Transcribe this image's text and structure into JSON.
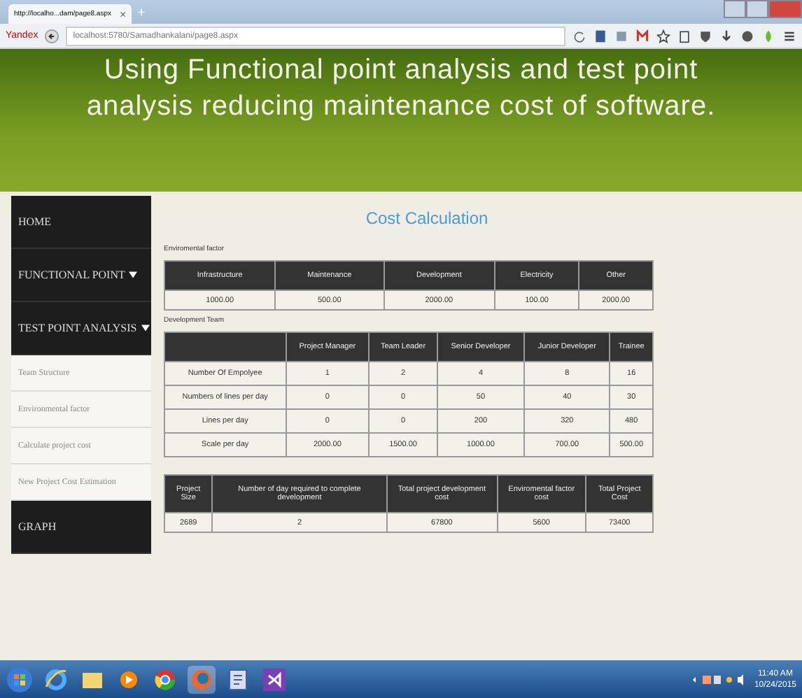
{
  "browser": {
    "tab_title": "http://localho...dam/page8.aspx",
    "tab_close": "×",
    "new_tab": "+",
    "logo": "Yandex",
    "url": "localhost:5780/Samadhankalani/page8.aspx"
  },
  "header": {
    "title": "Using Functional point analysis and test point analysis reducing maintenance cost of software."
  },
  "sidebar": {
    "items": [
      {
        "label": "HOME",
        "kind": "main",
        "expandable": false
      },
      {
        "label": "FUNCTIONAL POINT",
        "kind": "main",
        "expandable": true
      },
      {
        "label": "TEST POINT ANALYSIS",
        "kind": "main",
        "expandable": true
      },
      {
        "label": "Team Structure",
        "kind": "sub",
        "expandable": false
      },
      {
        "label": "Environmental factor",
        "kind": "sub",
        "expandable": false
      },
      {
        "label": "Calculate project cost",
        "kind": "sub",
        "expandable": false
      },
      {
        "label": "New Project Cost Estimation",
        "kind": "sub",
        "expandable": false
      },
      {
        "label": "GRAPH",
        "kind": "main",
        "expandable": false
      }
    ]
  },
  "content": {
    "title": "Cost Calculation",
    "sections": [
      {
        "label": "Enviromental factor",
        "columns": [
          "Infrastructure",
          "Maintenance",
          "Development",
          "Electricity",
          "Other"
        ],
        "rows": [
          [
            "1000.00",
            "500.00",
            "2000.00",
            "100.00",
            "2000.00"
          ]
        ]
      },
      {
        "label": "Development Team",
        "columns": [
          "",
          "Project Manager",
          "Team Leader",
          "Senior Developer",
          "Junior Developer",
          "Trainee"
        ],
        "rows": [
          [
            "Number Of Empolyee",
            "1",
            "2",
            "4",
            "8",
            "16"
          ],
          [
            "Numbers of lines per day",
            "0",
            "0",
            "50",
            "40",
            "30"
          ],
          [
            "Lines per day",
            "0",
            "0",
            "200",
            "320",
            "480"
          ],
          [
            "Scale per day",
            "2000.00",
            "1500.00",
            "1000.00",
            "700.00",
            "500.00"
          ]
        ]
      },
      {
        "columns": [
          "Project Size",
          "Number of day required to complete development",
          "Total project development cost",
          "Enviromental factor cost",
          "Total Project Cost"
        ],
        "rows": [
          [
            "2689",
            "2",
            "67800",
            "5600",
            "73400"
          ]
        ]
      }
    ]
  },
  "taskbar": {
    "time": "11:40 AM",
    "date": "10/24/2015"
  }
}
